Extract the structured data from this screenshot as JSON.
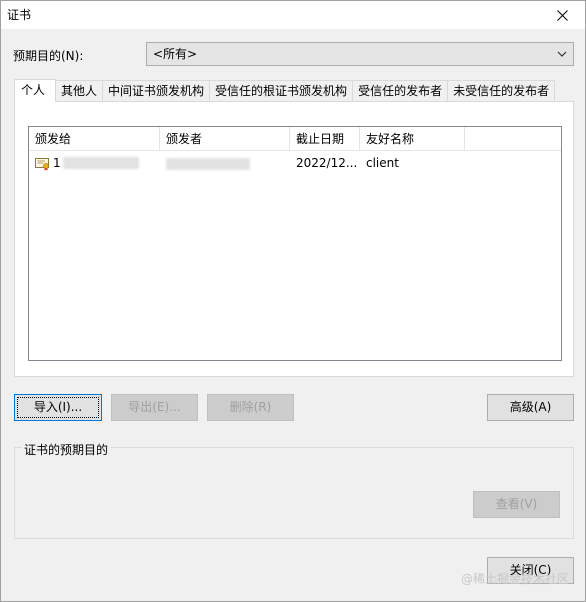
{
  "window": {
    "title": "证书"
  },
  "purpose": {
    "label": "预期目的(N):",
    "selected": "<所有>"
  },
  "tabs": [
    {
      "label": "个人"
    },
    {
      "label": "其他人"
    },
    {
      "label": "中间证书颁发机构"
    },
    {
      "label": "受信任的根证书颁发机构"
    },
    {
      "label": "受信任的发布者"
    },
    {
      "label": "未受信任的发布者"
    }
  ],
  "list": {
    "columns": [
      "颁发给",
      "颁发者",
      "截止日期",
      "友好名称"
    ],
    "rows": [
      {
        "issued_to": "1",
        "issued_by": "",
        "expiry": "2022/12...",
        "friendly_name": "client"
      }
    ]
  },
  "buttons": {
    "import": "导入(I)...",
    "export": "导出(E)...",
    "remove": "删除(R)",
    "advanced": "高级(A)",
    "view": "查看(V)",
    "close": "关闭(C)"
  },
  "group": {
    "label": "证书的预期目的"
  },
  "watermark": "@稀土掘金技术社区",
  "icons": {
    "close": "close-icon",
    "dropdown": "chevron-down-icon",
    "certificate": "certificate-icon"
  },
  "colors": {
    "window_bg": "#f0f0f0",
    "focus_border": "#0078d7",
    "disabled_text": "#a0a0a0"
  }
}
